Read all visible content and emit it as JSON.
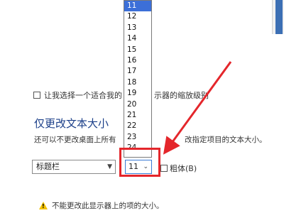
{
  "scaling": {
    "checkbox_label_start": "让我选择一个适合我的",
    "checkbox_label_end": "示器的缩放级别"
  },
  "text_size_section": {
    "title": "仅更改文本大小",
    "description_start": "还可以不更改桌面上所有",
    "description_end": "改指定项目的文本大小。"
  },
  "item_select": {
    "value": "标题栏"
  },
  "size_select": {
    "value": "11"
  },
  "size_options": [
    "11",
    "12",
    "13",
    "14",
    "15",
    "16",
    "17",
    "18",
    "19",
    "20",
    "21",
    "22",
    "23",
    "24"
  ],
  "selected_option": "11",
  "bold_checkbox": {
    "label": "粗体(B)"
  },
  "warning": {
    "text": "不能更改此显示器上的项的大小。"
  },
  "annotation": {
    "color": "#e4262b"
  }
}
